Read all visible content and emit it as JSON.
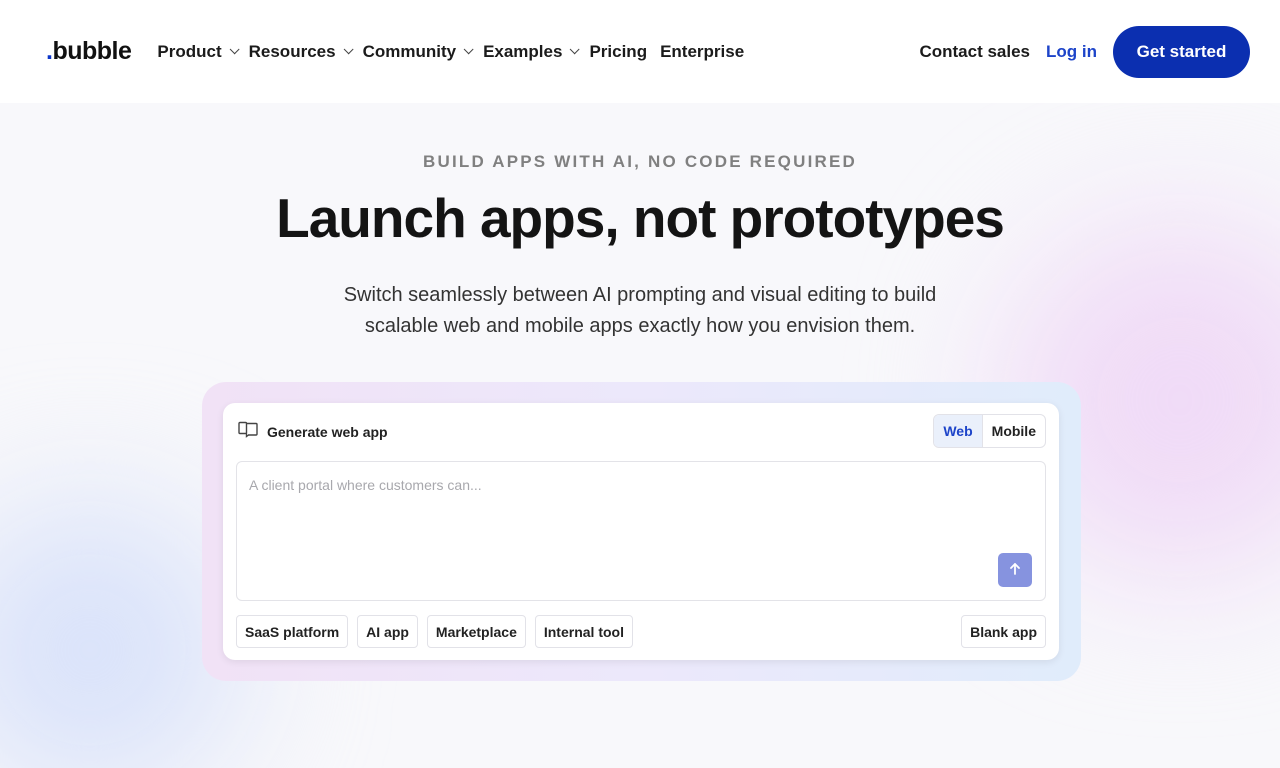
{
  "brand": {
    "logo_dot": ".",
    "logo_text": "bubble",
    "accent": "#0b2fb0"
  },
  "nav": {
    "items": [
      {
        "label": "Product",
        "has_dropdown": true
      },
      {
        "label": "Resources",
        "has_dropdown": true
      },
      {
        "label": "Community",
        "has_dropdown": true
      },
      {
        "label": "Examples",
        "has_dropdown": true
      },
      {
        "label": "Pricing",
        "has_dropdown": false
      },
      {
        "label": "Enterprise",
        "has_dropdown": false
      }
    ],
    "contact_sales": "Contact sales",
    "login": "Log in",
    "get_started": "Get started"
  },
  "hero": {
    "eyebrow": "BUILD APPS WITH AI, NO CODE REQUIRED",
    "headline": "Launch apps, not prototypes",
    "subhead_line1": "Switch seamlessly between AI prompting and visual editing to build",
    "subhead_line2": "scalable web and mobile apps exactly how you envision them."
  },
  "generator": {
    "title": "Generate web app",
    "title_icon": "book-open-icon",
    "platform_options": [
      "Web",
      "Mobile"
    ],
    "selected_platform": "Web",
    "prompt_value": "",
    "prompt_placeholder": "A client portal where customers can...",
    "send_icon": "arrow-up-icon",
    "templates": [
      "SaaS platform",
      "AI app",
      "Marketplace",
      "Internal tool"
    ],
    "blank_app": "Blank app"
  }
}
